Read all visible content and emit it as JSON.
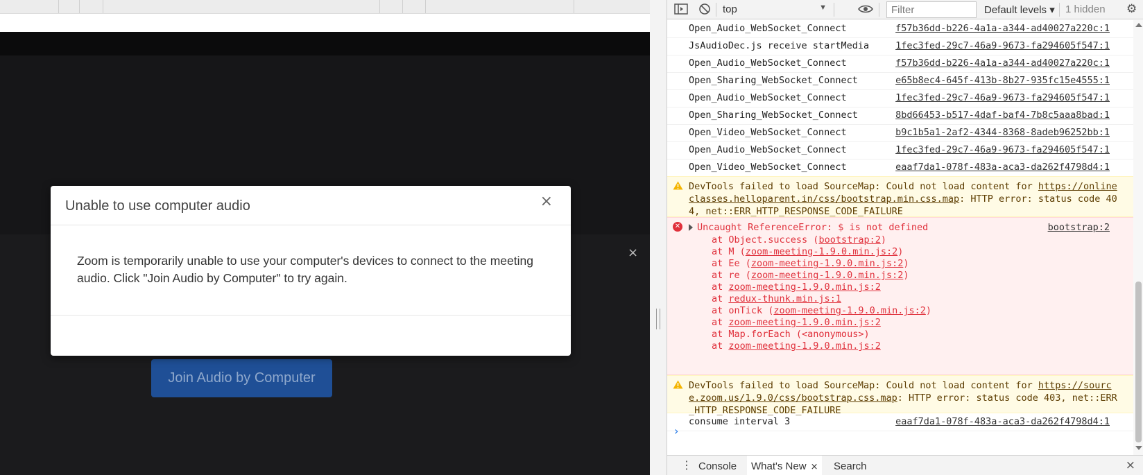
{
  "modal": {
    "title": "Unable to use computer audio",
    "message": "Zoom is temporarily unable to use your computer's devices to connect to the meeting audio. Click \"Join Audio by Computer\" to try again.",
    "close_glyph": "×"
  },
  "zoom": {
    "join_audio_label": "Join Audio by Computer",
    "panel_close_glyph": "×",
    "button_color": "#1f4f96"
  },
  "devtools": {
    "toolbar": {
      "context": "top",
      "filter_placeholder": "Filter",
      "levels": "Default levels ▾",
      "hidden": "1 hidden"
    },
    "logs": [
      {
        "text": "Open_Audio_WebSocket_Connect",
        "source": "f57b36dd-b226-4a1a-a344-ad40027a220c:1"
      },
      {
        "text": "JsAudioDec.js receive startMedia",
        "source": "1fec3fed-29c7-46a9-9673-fa294605f547:1"
      },
      {
        "text": "Open_Audio_WebSocket_Connect",
        "source": "f57b36dd-b226-4a1a-a344-ad40027a220c:1"
      },
      {
        "text": "Open_Sharing_WebSocket_Connect",
        "source": "e65b8ec4-645f-413b-8b27-935fc15e4555:1"
      },
      {
        "text": "Open_Audio_WebSocket_Connect",
        "source": "1fec3fed-29c7-46a9-9673-fa294605f547:1"
      },
      {
        "text": "Open_Sharing_WebSocket_Connect",
        "source": "8bd66453-b517-4daf-baf4-7b8c5aaa8bad:1"
      },
      {
        "text": "Open_Video_WebSocket_Connect",
        "source": "b9c1b5a1-2af2-4344-8368-8adeb96252bb:1"
      },
      {
        "text": "Open_Audio_WebSocket_Connect",
        "source": "1fec3fed-29c7-46a9-9673-fa294605f547:1"
      },
      {
        "text": "Open_Video_WebSocket_Connect",
        "source": "eaaf7da1-078f-483a-aca3-da262f4798d4:1"
      }
    ],
    "warning1": {
      "prefix": "DevTools failed to load SourceMap: Could not load content for ",
      "link": "https://onlineclasses.helloparent.in/css/bootstrap.min.css.map",
      "suffix": ": HTTP error: status code 404, net::ERR_HTTP_RESPONSE_CODE_FAILURE"
    },
    "error": {
      "head": "Uncaught ReferenceError: $ is not defined",
      "source": "bootstrap:2",
      "stack": [
        {
          "pre": "at Object.success (",
          "link": "bootstrap:2",
          "post": ")"
        },
        {
          "pre": "at M (",
          "link": "zoom-meeting-1.9.0.min.js:2",
          "post": ")"
        },
        {
          "pre": "at Ee (",
          "link": "zoom-meeting-1.9.0.min.js:2",
          "post": ")"
        },
        {
          "pre": "at re (",
          "link": "zoom-meeting-1.9.0.min.js:2",
          "post": ")"
        },
        {
          "pre": "at ",
          "link": "zoom-meeting-1.9.0.min.js:2",
          "post": ""
        },
        {
          "pre": "at ",
          "link": "redux-thunk.min.js:1",
          "post": ""
        },
        {
          "pre": "at onTick (",
          "link": "zoom-meeting-1.9.0.min.js:2",
          "post": ")"
        },
        {
          "pre": "at ",
          "link": "zoom-meeting-1.9.0.min.js:2",
          "post": ""
        },
        {
          "pre": "at Map.forEach (<anonymous>)",
          "link": "",
          "post": ""
        },
        {
          "pre": "at ",
          "link": "zoom-meeting-1.9.0.min.js:2",
          "post": ""
        }
      ]
    },
    "warning2": {
      "prefix": "DevTools failed to load SourceMap: Could not load content for ",
      "link": "https://source.zoom.us/1.9.0/css/bootstrap.css.map",
      "suffix": ": HTTP error: status code 403, net::ERR_HTTP_RESPONSE_CODE_FAILURE"
    },
    "last_log": {
      "text": "consume interval 3",
      "source": "eaaf7da1-078f-483a-aca3-da262f4798d4:1"
    },
    "prompt_glyph": "›",
    "drawer": {
      "menu_glyph": "⋮",
      "tabs": [
        "Console",
        "What's New",
        "Search"
      ],
      "tab_close_glyph": "×",
      "close_glyph": "×"
    },
    "colors": {
      "error": "#e0303b",
      "warning_bg": "#fffbe5",
      "error_bg": "#fff0f0",
      "prompt": "#1a73e8"
    }
  }
}
